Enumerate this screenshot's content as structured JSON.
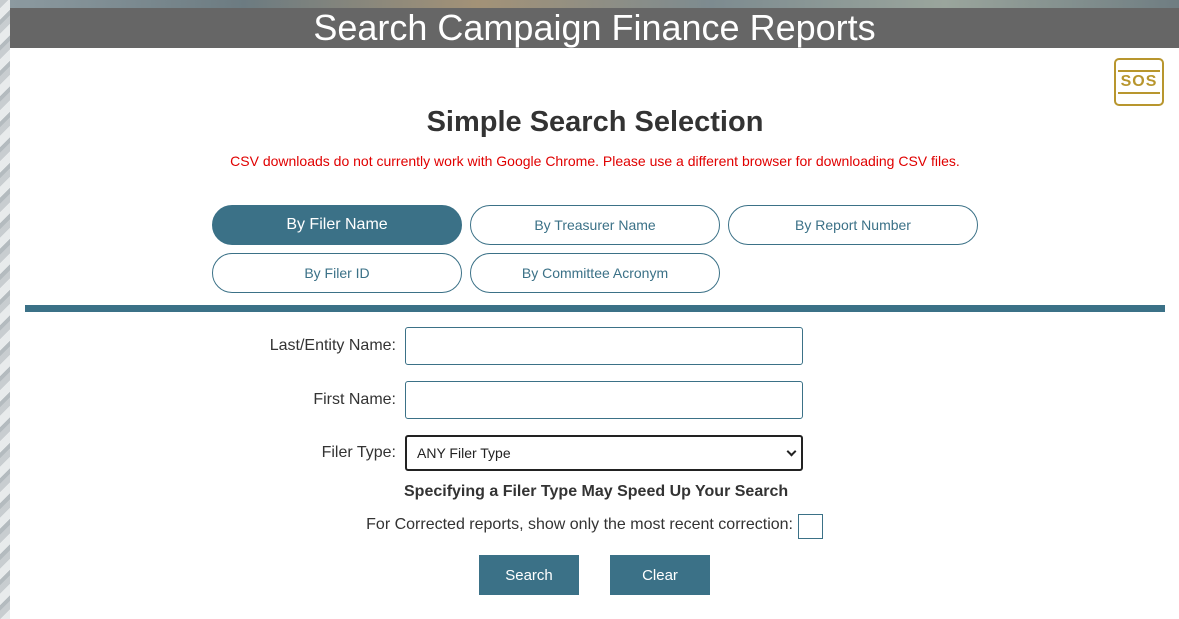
{
  "header": {
    "title": "Search Campaign Finance Reports",
    "logo_text": "SOS"
  },
  "main": {
    "heading": "Simple Search Selection",
    "notice": "CSV downloads do not currently work with Google Chrome. Please use a different browser for downloading CSV files.",
    "tabs": [
      {
        "label": "By Filer Name",
        "active": true
      },
      {
        "label": "By Treasurer Name",
        "active": false
      },
      {
        "label": "By Report Number",
        "active": false
      },
      {
        "label": "By Filer ID",
        "active": false
      },
      {
        "label": "By Committee Acronym",
        "active": false
      }
    ]
  },
  "form": {
    "last_name_label": "Last/Entity Name:",
    "last_name_value": "",
    "first_name_label": "First Name:",
    "first_name_value": "",
    "filer_type_label": "Filer Type:",
    "filer_type_selected": "ANY Filer Type",
    "filer_type_hint": "Specifying a Filer Type May Speed Up Your Search",
    "corrected_label": "For Corrected reports, show only the most recent correction:",
    "corrected_checked": false,
    "search_label": "Search",
    "clear_label": "Clear"
  },
  "colors": {
    "accent": "#3b7187",
    "title_bar": "#666666",
    "notice": "#e00000",
    "logo": "#b8962e"
  }
}
